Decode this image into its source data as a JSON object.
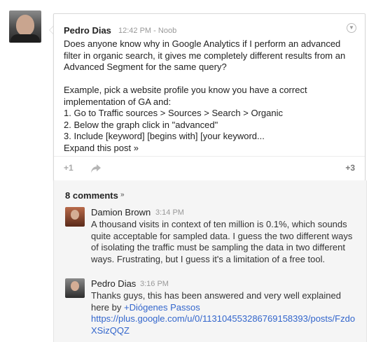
{
  "post": {
    "author": "Pedro Dias",
    "timestamp": "12:42 PM",
    "visibility": "Noob",
    "body": "Does anyone know why in Google Analytics if I perform an advanced filter in organic search, it gives me completely different results from an Advanced Segment for the same query?\n\nExample, pick a website profile you know you have a correct implementation of GA and:\n1. Go to Traffic sources > Sources > Search > Organic\n2. Below the graph click in \"advanced\"\n3. Include [keyword] [begins with] [your keyword...",
    "expand_label": "Expand this post »",
    "plus_one_label": "+1",
    "plus_count": "+3"
  },
  "comments": {
    "header": "8 comments",
    "items": [
      {
        "author": "Damion Brown",
        "timestamp": "3:14 PM",
        "text": "A thousand visits in context of ten million is 0.1%, which sounds quite acceptable for sampled data. I guess the two different ways of isolating the traffic must be sampling the data in two different ways. Frustrating, but I guess it's a limitation of a free tool."
      },
      {
        "author": "Pedro Dias",
        "timestamp": "3:16 PM",
        "text_before": "Thanks guys, this has been answered and very well explained here by ",
        "mention": "+Diógenes Passos",
        "link": "https://plus.google.com/u/0/113104553286769158393/posts/FzdoXSizQQZ"
      }
    ]
  },
  "colors": {
    "link": "#3366cc",
    "comments_bg": "#f5f5f5"
  }
}
